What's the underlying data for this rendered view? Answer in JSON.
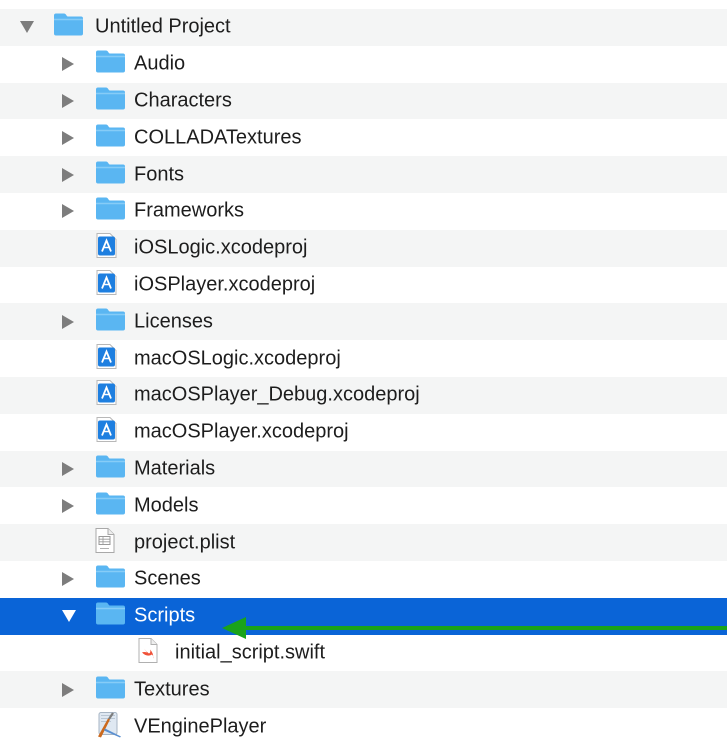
{
  "tree": {
    "items": [
      {
        "label": "Untitled Project",
        "type": "folder",
        "level": 0,
        "disclosure": "open"
      },
      {
        "label": "Audio",
        "type": "folder",
        "level": 1,
        "disclosure": "closed"
      },
      {
        "label": "Characters",
        "type": "folder",
        "level": 1,
        "disclosure": "closed"
      },
      {
        "label": "COLLADATextures",
        "type": "folder",
        "level": 1,
        "disclosure": "closed"
      },
      {
        "label": "Fonts",
        "type": "folder",
        "level": 1,
        "disclosure": "closed"
      },
      {
        "label": "Frameworks",
        "type": "folder",
        "level": 1,
        "disclosure": "closed"
      },
      {
        "label": "iOSLogic.xcodeproj",
        "type": "xcodeproj",
        "level": 1,
        "disclosure": "none"
      },
      {
        "label": "iOSPlayer.xcodeproj",
        "type": "xcodeproj",
        "level": 1,
        "disclosure": "none"
      },
      {
        "label": "Licenses",
        "type": "folder",
        "level": 1,
        "disclosure": "closed"
      },
      {
        "label": "macOSLogic.xcodeproj",
        "type": "xcodeproj",
        "level": 1,
        "disclosure": "none"
      },
      {
        "label": "macOSPlayer_Debug.xcodeproj",
        "type": "xcodeproj",
        "level": 1,
        "disclosure": "none"
      },
      {
        "label": "macOSPlayer.xcodeproj",
        "type": "xcodeproj",
        "level": 1,
        "disclosure": "none"
      },
      {
        "label": "Materials",
        "type": "folder",
        "level": 1,
        "disclosure": "closed"
      },
      {
        "label": "Models",
        "type": "folder",
        "level": 1,
        "disclosure": "closed"
      },
      {
        "label": "project.plist",
        "type": "plist",
        "level": 1,
        "disclosure": "none"
      },
      {
        "label": "Scenes",
        "type": "folder",
        "level": 1,
        "disclosure": "closed"
      },
      {
        "label": "Scripts",
        "type": "folder",
        "level": 1,
        "disclosure": "open",
        "selected": true
      },
      {
        "label": "initial_script.swift",
        "type": "swift",
        "level": 2,
        "disclosure": "none"
      },
      {
        "label": "Textures",
        "type": "folder",
        "level": 1,
        "disclosure": "closed"
      },
      {
        "label": "VEnginePlayer",
        "type": "app",
        "level": 1,
        "disclosure": "none"
      }
    ]
  },
  "icons": {
    "folder": "folder-icon",
    "xcodeproj": "xcodeproj-icon",
    "plist": "plist-file-icon",
    "swift": "swift-file-icon",
    "app": "app-icon"
  },
  "colors": {
    "selection": "#0a64d7",
    "folder": "#5ab6f2",
    "alt_row": "#f4f5f5",
    "arrow": "#1aa31a"
  }
}
